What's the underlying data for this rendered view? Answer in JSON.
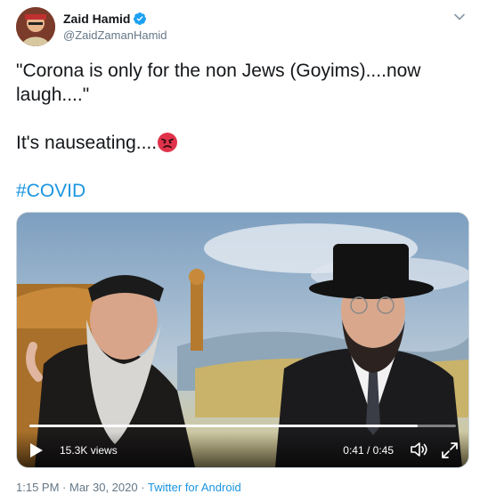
{
  "author": {
    "name": "Zaid Hamid",
    "handle": "@ZaidZamanHamid",
    "verified": true
  },
  "tweet": {
    "line1": "\"Corona is only for the non Jews (Goyims)....now laugh....\"",
    "line2": "It's nauseating....",
    "emoji": "angry-face",
    "hashtag": "#COVID"
  },
  "video": {
    "views": "15.3K views",
    "time": "0:41 / 0:45",
    "progress": 0.91
  },
  "footer": {
    "time": "1:15 PM",
    "sep1": " · ",
    "date": "Mar 30, 2020",
    "sep2": " · ",
    "source": "Twitter for Android"
  },
  "colors": {
    "link": "#1b95e0",
    "secondary_text": "#657786",
    "verified_badge": "#1da1f2"
  }
}
